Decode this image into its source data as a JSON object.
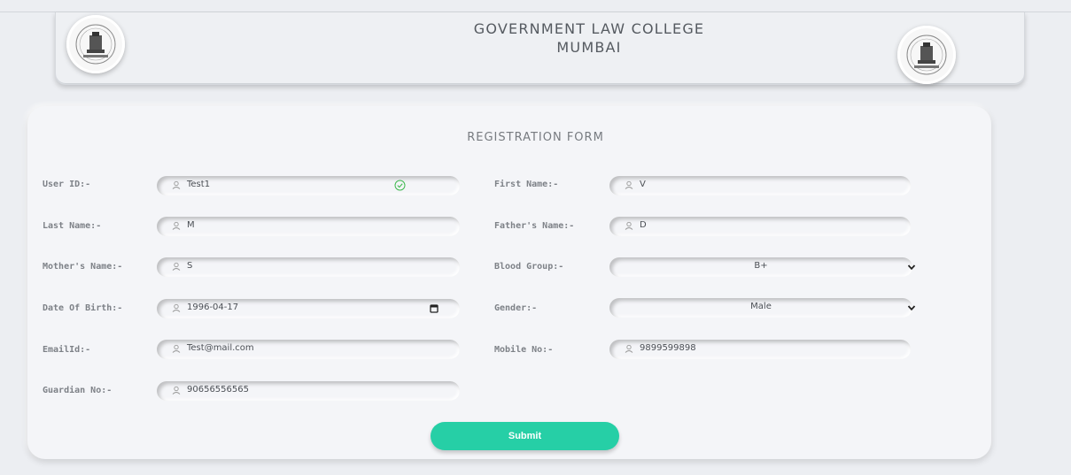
{
  "header": {
    "title_line1": "GOVERNMENT LAW COLLEGE",
    "title_line2": "MUMBAI",
    "logo_left": "college-crest-logo",
    "logo_right": "college-crest-logo"
  },
  "form": {
    "title": "REGISTRATION FORM",
    "fields": {
      "user_id": {
        "label": "User ID:-",
        "value": "Test1",
        "icon": "user-icon",
        "status_icon": "check-circle-icon"
      },
      "first_name": {
        "label": "First Name:-",
        "value": "V",
        "icon": "user-icon"
      },
      "last_name": {
        "label": "Last Name:-",
        "value": "M",
        "icon": "user-icon"
      },
      "father_name": {
        "label": "Father's Name:-",
        "value": "D",
        "icon": "user-icon"
      },
      "mother_name": {
        "label": "Mother's Name:-",
        "value": "S",
        "icon": "user-icon"
      },
      "blood_group": {
        "label": "Blood Group:-",
        "value": "B+",
        "icon": "chevron-down-icon"
      },
      "dob": {
        "label": "Date Of Birth:-",
        "value": "1996-04-17",
        "icon": "user-icon",
        "picker_icon": "calendar-icon"
      },
      "gender": {
        "label": "Gender:-",
        "value": "Male",
        "icon": "chevron-down-icon"
      },
      "email": {
        "label": "EmailId:-",
        "value": "Test@mail.com",
        "icon": "user-icon"
      },
      "mobile": {
        "label": "Mobile No:-",
        "value": "9899599898",
        "icon": "user-icon"
      },
      "guardian": {
        "label": "Guardian No:-",
        "value": "90656556565",
        "icon": "user-icon"
      }
    },
    "submit_label": "Submit"
  },
  "colors": {
    "accent": "#26cfa6",
    "background": "#eceef2",
    "card": "#f4f5f8",
    "success": "#3fb950"
  }
}
